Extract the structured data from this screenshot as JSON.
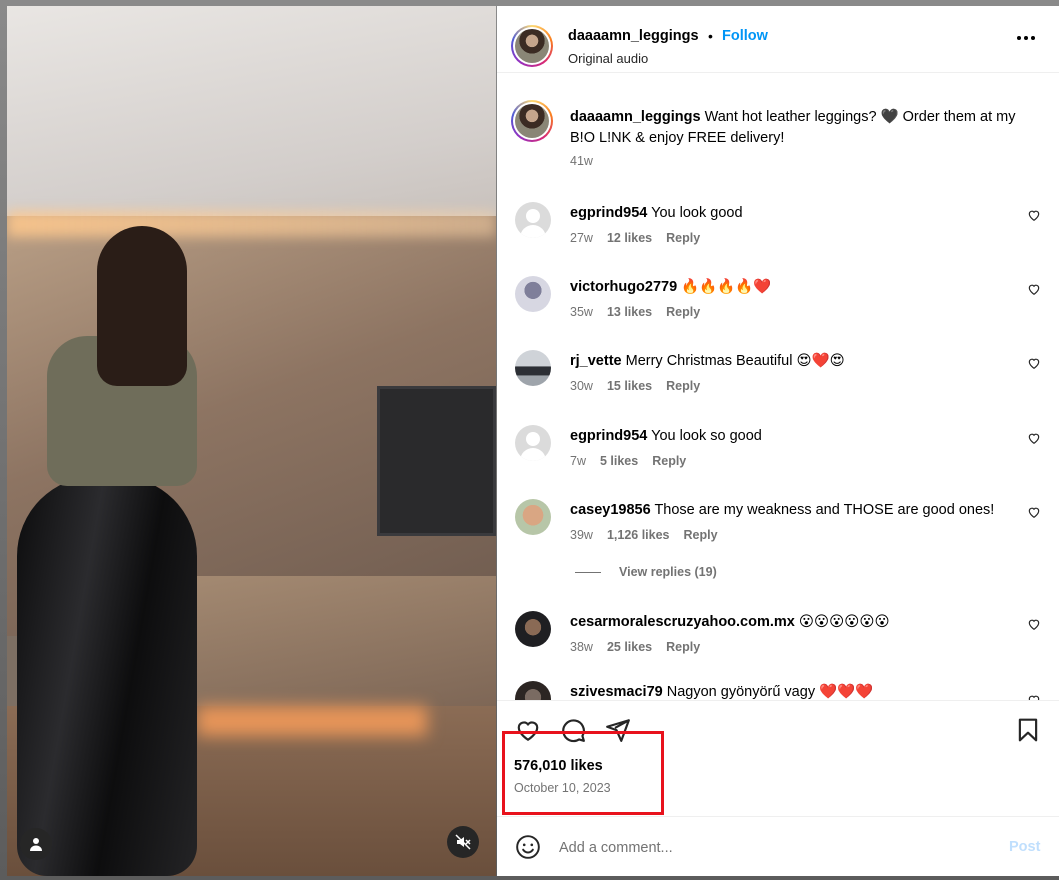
{
  "post": {
    "author": "daaaamn_leggings",
    "separator": "•",
    "follow_label": "Follow",
    "audio": "Original audio",
    "caption": "Want hot leather leggings? 🖤 Order them at my B!O L!NK & enjoy FREE delivery!",
    "caption_time": "41w"
  },
  "comments": [
    {
      "user": "egprind954",
      "text": "You look good",
      "time": "27w",
      "likes": "12 likes",
      "reply": "Reply"
    },
    {
      "user": "victorhugo2779",
      "text": "🔥🔥🔥🔥❤️",
      "time": "35w",
      "likes": "13 likes",
      "reply": "Reply"
    },
    {
      "user": "rj_vette",
      "text": "Merry Christmas Beautiful 😍❤️😍",
      "time": "30w",
      "likes": "15 likes",
      "reply": "Reply"
    },
    {
      "user": "egprind954",
      "text": "You look so good",
      "time": "7w",
      "likes": "5 likes",
      "reply": "Reply"
    },
    {
      "user": "casey19856",
      "text": "Those are my weakness and THOSE are good ones!",
      "time": "39w",
      "likes": "1,126 likes",
      "reply": "Reply"
    },
    {
      "user": "cesarmoralescruzyahoo.com.mx",
      "text": "😮😮😮😮😮😮",
      "time": "38w",
      "likes": "25 likes",
      "reply": "Reply"
    },
    {
      "user": "szivesmaci79",
      "text": "Nagyon gyönyörű vagy ❤️❤️❤️",
      "time": "",
      "likes": "",
      "reply": ""
    }
  ],
  "view_replies": "View replies (19)",
  "stats": {
    "likes": "576,010 likes",
    "date": "October 10, 2023"
  },
  "comment_box": {
    "placeholder": "Add a comment...",
    "post_label": "Post"
  },
  "colors": {
    "follow": "#0095f6",
    "highlight": "#e8121c",
    "muted": "#737373"
  },
  "icons": [
    "user-tag-icon",
    "mute-icon",
    "more-icon",
    "heart-icon",
    "comment-icon",
    "share-icon",
    "save-icon",
    "emoji-icon"
  ]
}
